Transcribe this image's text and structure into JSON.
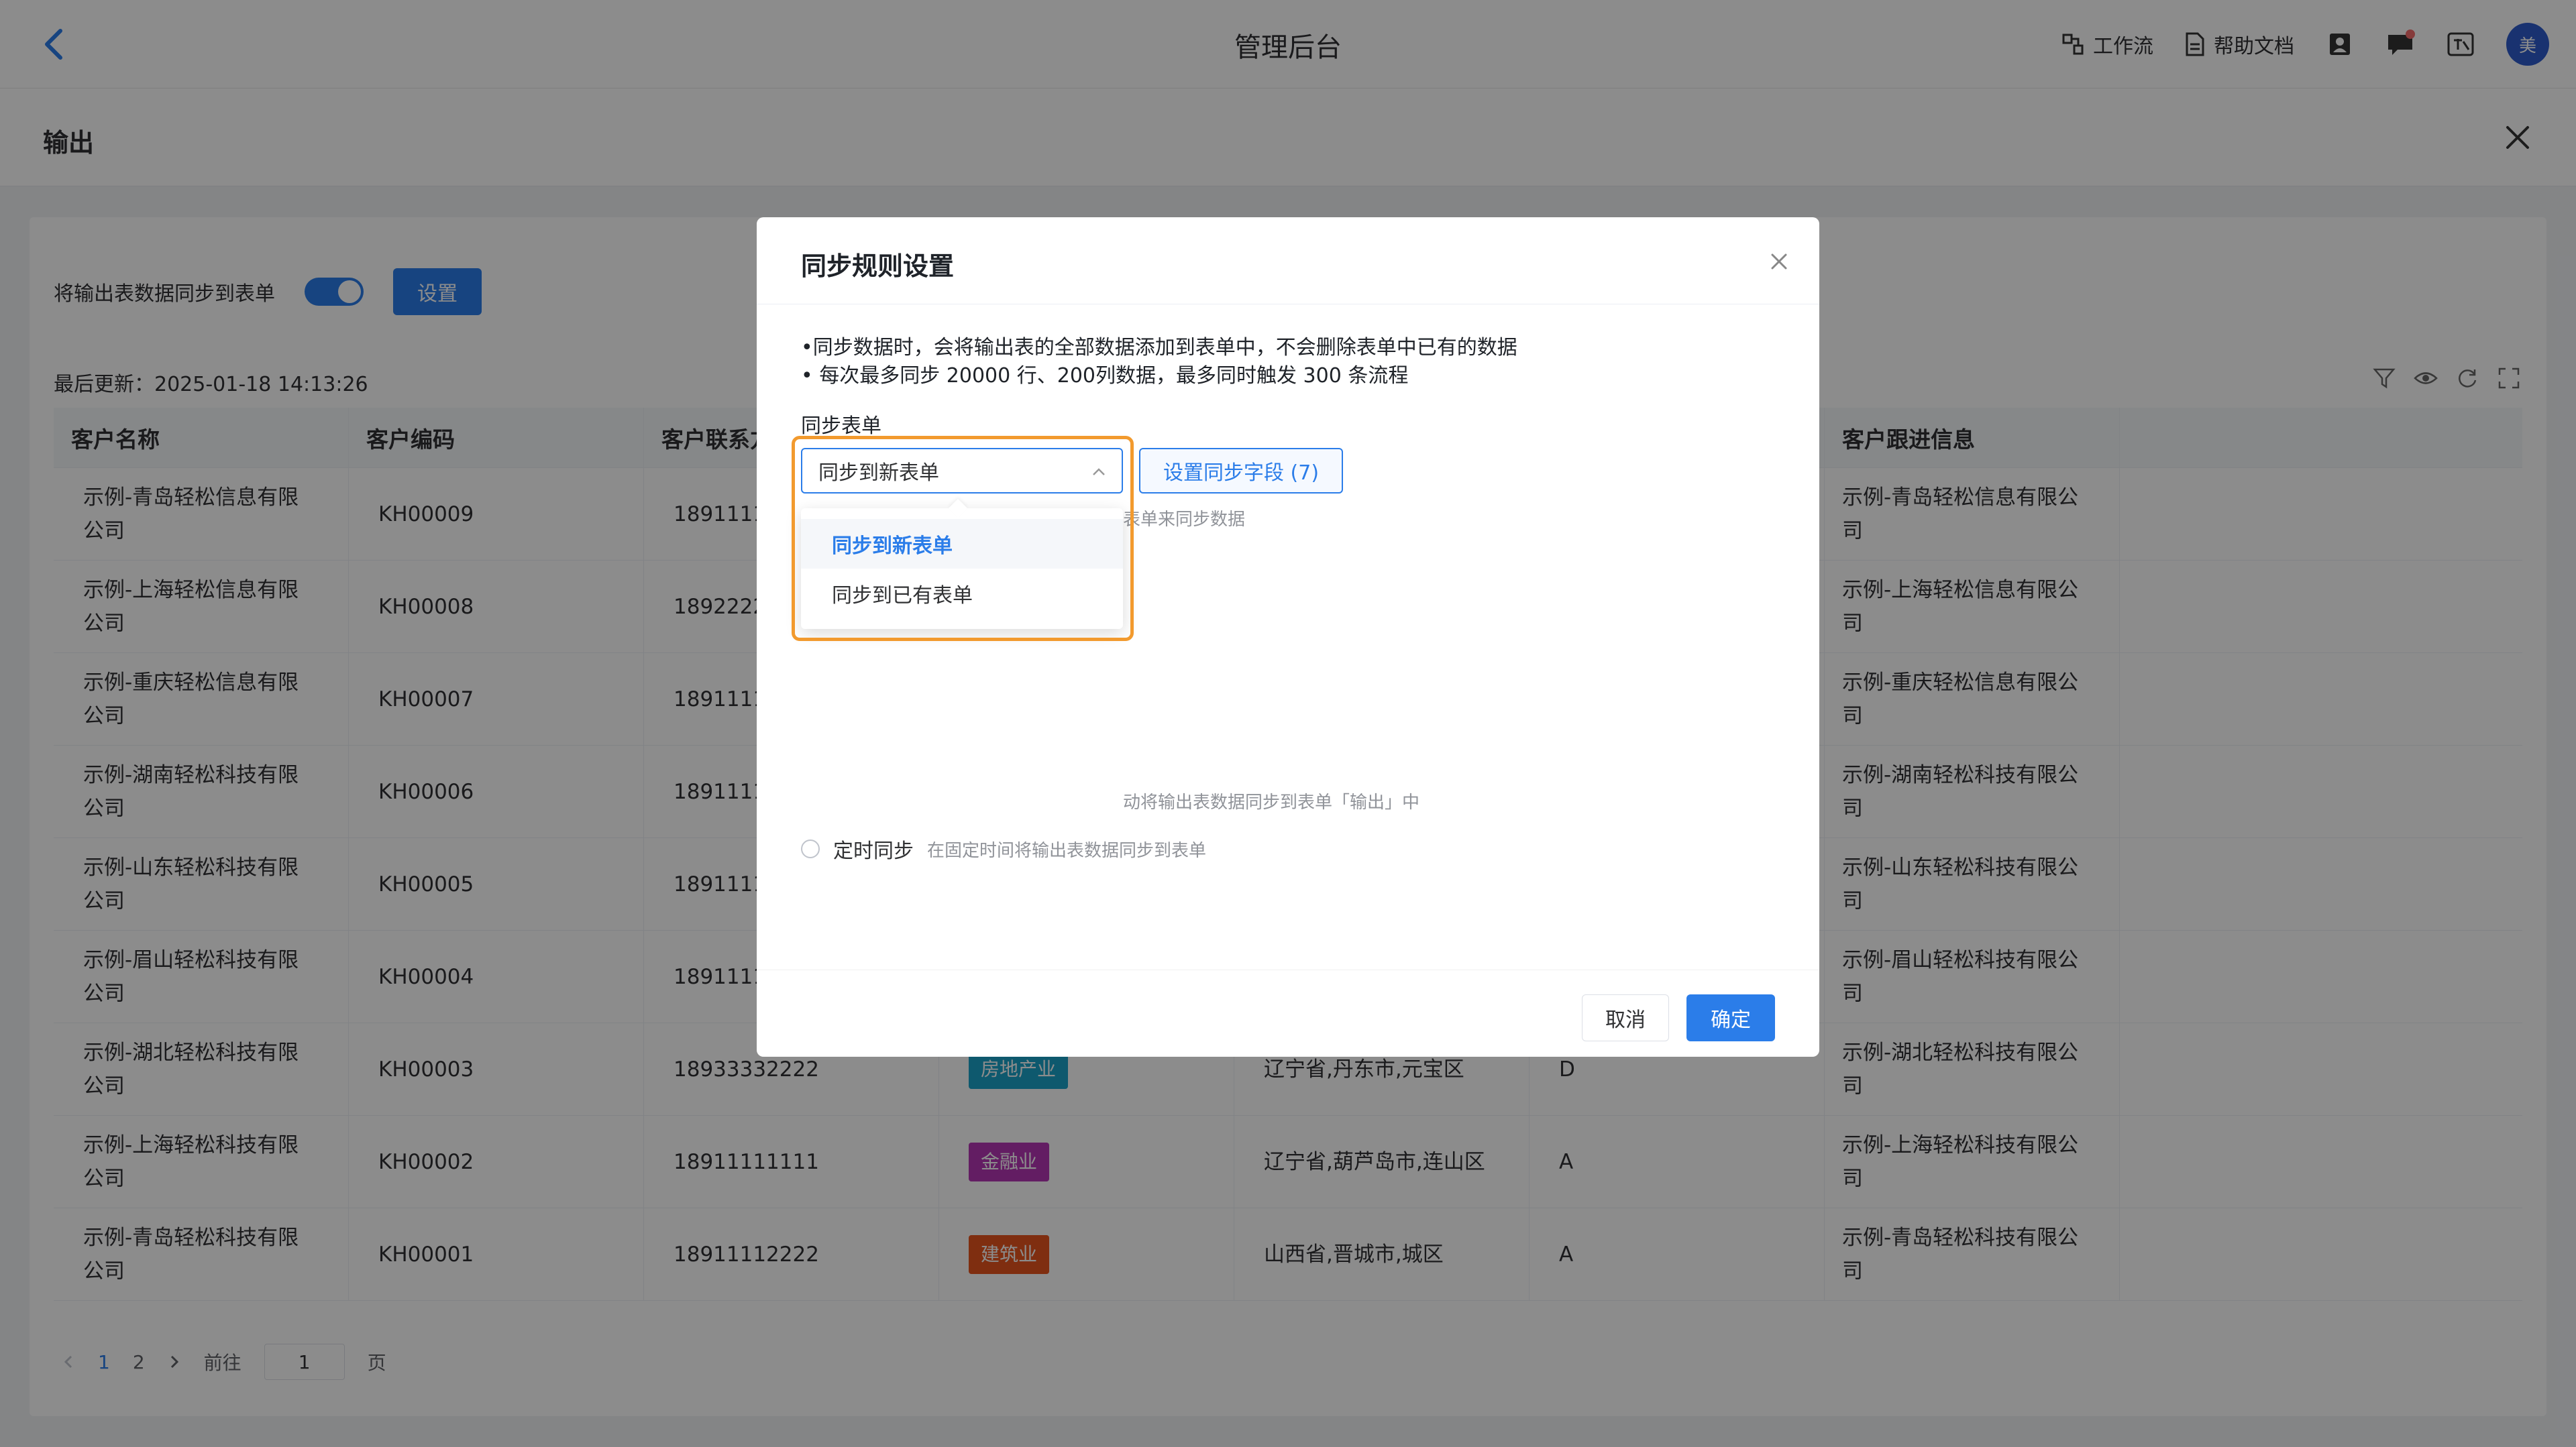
{
  "topbar": {
    "title": "管理后台",
    "workflow_label": "工作流",
    "docs_label": "帮助文档",
    "avatar_text": "美"
  },
  "drawer": {
    "title": "输出",
    "sync_label": "将输出表数据同步到表单",
    "sync_enabled": true,
    "settings_button": "设置",
    "last_update": "最后更新：2025-01-18 14:13:26",
    "columns": [
      "客户名称",
      "客户编码",
      "客户联系方式",
      "",
      "",
      "",
      "客户跟进信息"
    ],
    "rows": [
      {
        "name": "示例-青岛轻松信息有限公司",
        "code": "KH00009",
        "phone": "18911111",
        "industry": "",
        "industry_color": "",
        "region": "",
        "level": "",
        "follow": "示例-青岛轻松信息有限公司"
      },
      {
        "name": "示例-上海轻松信息有限公司",
        "code": "KH00008",
        "phone": "18922222",
        "industry": "",
        "industry_color": "",
        "region": "",
        "level": "",
        "follow": "示例-上海轻松信息有限公司"
      },
      {
        "name": "示例-重庆轻松信息有限公司",
        "code": "KH00007",
        "phone": "18911111",
        "industry": "",
        "industry_color": "",
        "region": "",
        "level": "",
        "follow": "示例-重庆轻松信息有限公司"
      },
      {
        "name": "示例-湖南轻松科技有限公司",
        "code": "KH00006",
        "phone": "18911111",
        "industry": "",
        "industry_color": "",
        "region": "",
        "level": "",
        "follow": "示例-湖南轻松科技有限公司"
      },
      {
        "name": "示例-山东轻松科技有限公司",
        "code": "KH00005",
        "phone": "18911111",
        "industry": "",
        "industry_color": "",
        "region": "",
        "level": "",
        "follow": "示例-山东轻松科技有限公司"
      },
      {
        "name": "示例-眉山轻松科技有限公司",
        "code": "KH00004",
        "phone": "18911111",
        "industry": "",
        "industry_color": "",
        "region": "",
        "level": "",
        "follow": "示例-眉山轻松科技有限公司"
      },
      {
        "name": "示例-湖北轻松科技有限公司",
        "code": "KH00003",
        "phone": "18933332222",
        "industry": "房地产业",
        "industry_color": "#1aa3c8",
        "region": "辽宁省,丹东市,元宝区",
        "level": "D",
        "follow": "示例-湖北轻松科技有限公司"
      },
      {
        "name": "示例-上海轻松科技有限公司",
        "code": "KH00002",
        "phone": "18911111111",
        "industry": "金融业",
        "industry_color": "#b535b5",
        "region": "辽宁省,葫芦岛市,连山区",
        "level": "A",
        "follow": "示例-上海轻松科技有限公司"
      },
      {
        "name": "示例-青岛轻松科技有限公司",
        "code": "KH00001",
        "phone": "18911112222",
        "industry": "建筑业",
        "industry_color": "#e8541e",
        "region": "山西省,晋城市,城区",
        "level": "A",
        "follow": "示例-青岛轻松科技有限公司"
      }
    ],
    "pager": {
      "page1": "1",
      "page2": "2",
      "goto_label": "前往",
      "goto_value": "1",
      "page_suffix": "页"
    }
  },
  "modal": {
    "title": "同步规则设置",
    "notice_1": "•同步数据时，会将输出表的全部数据添加到表单中，不会删除表单中已有的数据",
    "notice_2": "• 每次最多同步 20000 行、200列数据，最多同时触发 300 条流程",
    "field_label": "同步表单",
    "select_value": "同步到新表单",
    "set_fields_button": "设置同步字段 (7)",
    "hint_text": "表单来同步数据",
    "auto_sync_desc": "动将输出表数据同步到表单「输出」中",
    "scheduled_label": "定时同步",
    "scheduled_desc": "在固定时间将输出表数据同步到表单",
    "cancel_button": "取消",
    "ok_button": "确定"
  },
  "dropdown": {
    "options": [
      "同步到新表单",
      "同步到已有表单"
    ],
    "selected_index": 0
  },
  "colors": {
    "primary": "#2b7de9",
    "highlight": "#f29a2e"
  }
}
